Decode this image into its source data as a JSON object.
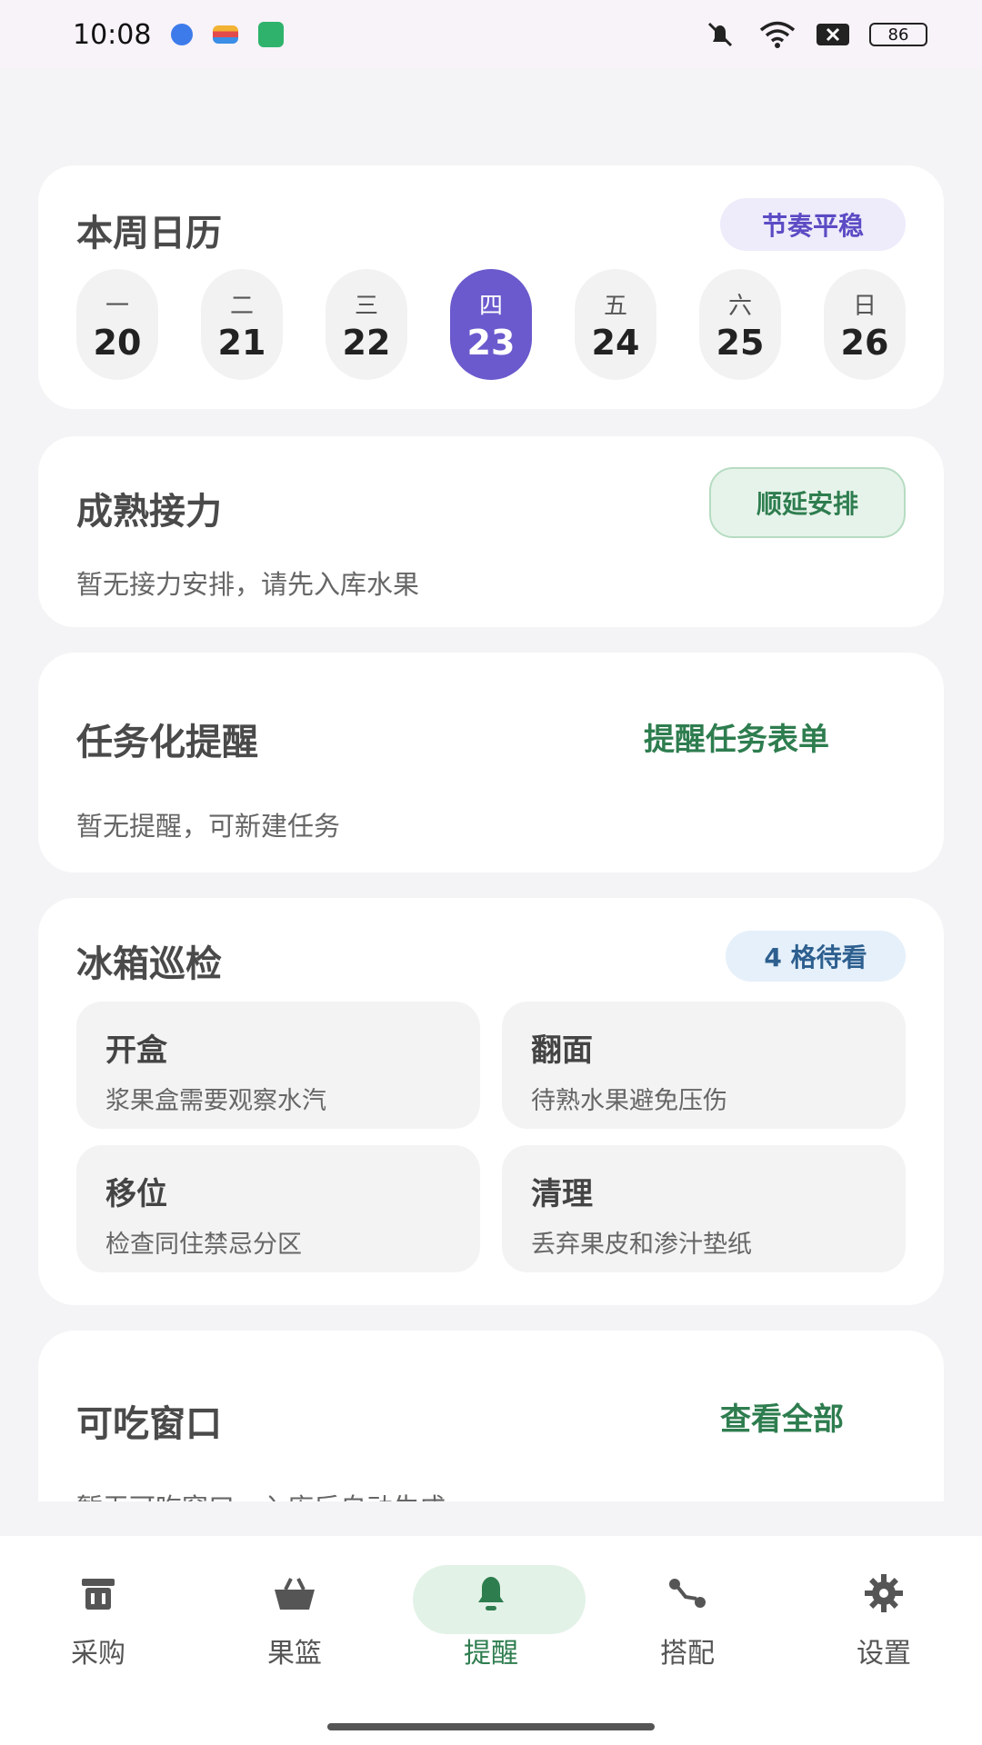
{
  "status_bar": {
    "time": "10:08",
    "battery": "86",
    "icons": [
      "app-notification-blue",
      "wallet-notification",
      "security-notification",
      "mute-icon",
      "wifi-icon",
      "data-off-icon"
    ]
  },
  "calendar": {
    "title": "本周日历",
    "badge": "节奏平稳",
    "days": [
      {
        "weekday": "一",
        "date": "20"
      },
      {
        "weekday": "二",
        "date": "21"
      },
      {
        "weekday": "三",
        "date": "22"
      },
      {
        "weekday": "四",
        "date": "23"
      },
      {
        "weekday": "五",
        "date": "24"
      },
      {
        "weekday": "六",
        "date": "25"
      },
      {
        "weekday": "日",
        "date": "26"
      }
    ],
    "selected_index": 3
  },
  "relay": {
    "title": "成熟接力",
    "button": "顺延安排",
    "empty_text": "暂无接力安排，请先入库水果"
  },
  "reminder": {
    "title": "任务化提醒",
    "link": "提醒任务表单",
    "empty_text": "暂无提醒，可新建任务"
  },
  "fridge": {
    "title": "冰箱巡检",
    "badge": "4 格待看",
    "tiles": [
      {
        "title": "开盒",
        "desc": "浆果盒需要观察水汽"
      },
      {
        "title": "翻面",
        "desc": "待熟水果避免压伤"
      },
      {
        "title": "移位",
        "desc": "检查同住禁忌分区"
      },
      {
        "title": "清理",
        "desc": "丢弃果皮和渗汁垫纸"
      }
    ]
  },
  "edible": {
    "title": "可吃窗口",
    "link": "查看全部",
    "empty_text": "暂无可吃窗口，入库后自动生成"
  },
  "nav": {
    "items": [
      {
        "label": "采购",
        "icon": "trash-bin-icon"
      },
      {
        "label": "果篮",
        "icon": "basket-icon"
      },
      {
        "label": "提醒",
        "icon": "bell-icon"
      },
      {
        "label": "搭配",
        "icon": "pairing-icon"
      },
      {
        "label": "设置",
        "icon": "gear-icon"
      }
    ],
    "active_index": 2
  },
  "colors": {
    "accent_purple": "#6a5acd",
    "accent_green": "#2e7d4f",
    "nav_active_bg": "#e3f2e7"
  }
}
